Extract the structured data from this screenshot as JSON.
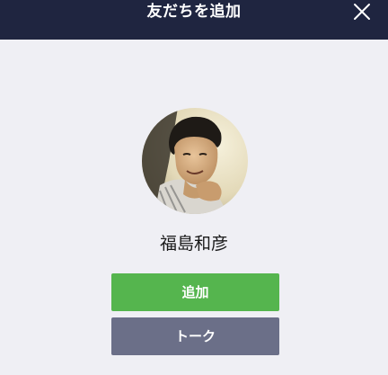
{
  "header": {
    "title": "友だちを追加",
    "close_icon": "close-icon"
  },
  "profile": {
    "name": "福島和彦",
    "avatar_icon": "avatar-photo"
  },
  "actions": {
    "add_label": "追加",
    "talk_label": "トーク"
  },
  "colors": {
    "header_bg": "#1f2540",
    "page_bg": "#efeff4",
    "add_button": "#55b54e",
    "talk_button": "#6b6f88"
  }
}
